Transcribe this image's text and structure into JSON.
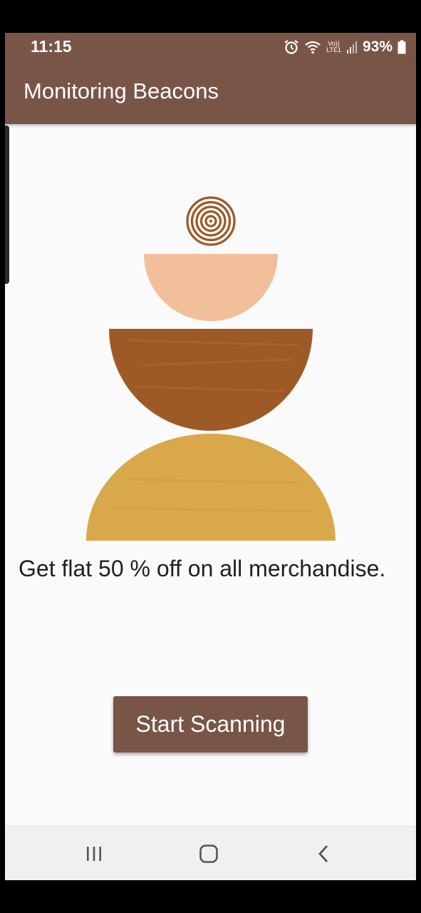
{
  "status_bar": {
    "time": "11:15",
    "battery": "93%",
    "network_top": "Vo))",
    "network_bottom": "LTE1",
    "icons": [
      "alarm-icon",
      "wifi-icon",
      "signal-icon",
      "battery-icon"
    ]
  },
  "app_bar": {
    "title": "Monitoring Beacons"
  },
  "main": {
    "promo_text": "Get flat 50 % off on all merchandise.",
    "start_button_label": "Start Scanning"
  },
  "nav_bar": {
    "icons": [
      "recent-apps-icon",
      "home-icon",
      "back-icon"
    ]
  },
  "colors": {
    "primary": "#795548",
    "background": "#fafafa",
    "illustration_rings": "#9a5a24",
    "illustration_peach": "#f1c09b",
    "illustration_brown": "#9e5a26",
    "illustration_mustard": "#d9a84a"
  }
}
